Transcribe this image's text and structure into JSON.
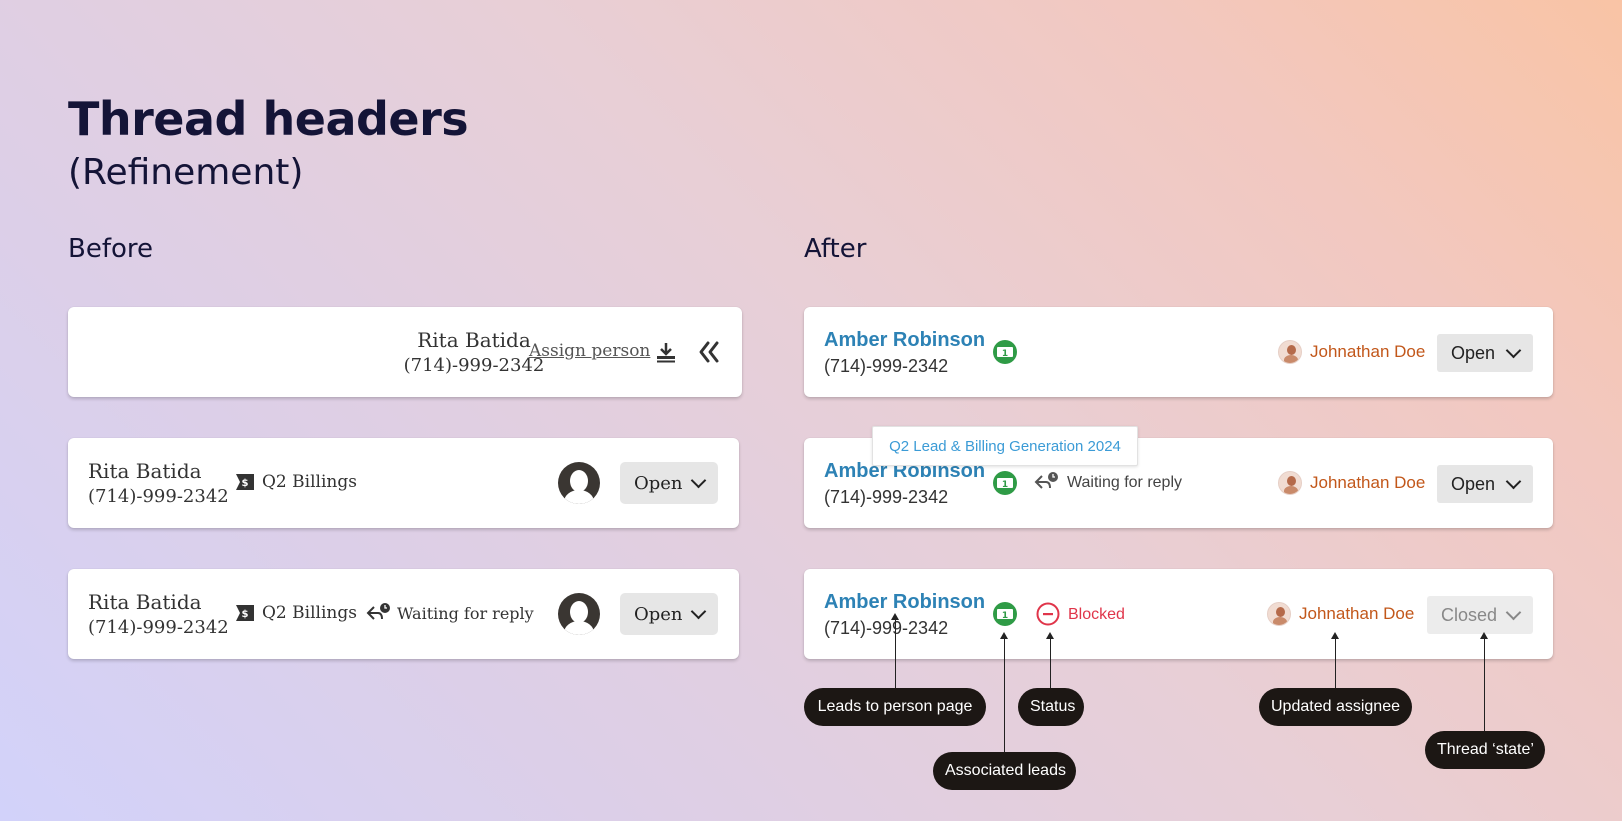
{
  "title": "Thread headers",
  "subtitle": "(Refinement)",
  "before": {
    "heading": "Before",
    "card1": {
      "name": "Rita Batida",
      "phone": "(714)-999-2342",
      "assign": "Assign person"
    },
    "card2": {
      "name": "Rita Batida",
      "phone": "(714)-999-2342",
      "tag": "Q2 Billings",
      "state": "Open"
    },
    "card3": {
      "name": "Rita Batida",
      "phone": "(714)-999-2342",
      "tag": "Q2 Billings",
      "waiting": "Waiting for reply",
      "state": "Open"
    }
  },
  "after": {
    "heading": "After",
    "card1": {
      "name": "Amber Robinson",
      "phone": "(714)-999-2342",
      "assignee": "Johnathan Doe",
      "state": "Open"
    },
    "card2": {
      "name": "Amber Robinson",
      "phone": "(714)-999-2342",
      "waiting": "Waiting for reply",
      "assignee": "Johnathan Doe",
      "state": "Open",
      "tooltip": "Q2 Lead & Billing Generation 2024"
    },
    "card3": {
      "name": "Amber Robinson",
      "phone": "(714)-999-2342",
      "status": "Blocked",
      "assignee": "Johnathan Doe",
      "state": "Closed"
    }
  },
  "callouts": {
    "person": "Leads to person page",
    "leads": "Associated leads",
    "status": "Status",
    "assignee": "Updated assignee",
    "state": "Thread ‘state’"
  },
  "colors": {
    "name_blue": "#2d82b5",
    "assignee_orange": "#c2571a",
    "lead_green": "#2f9b46",
    "blocked_red": "#e0354a"
  }
}
